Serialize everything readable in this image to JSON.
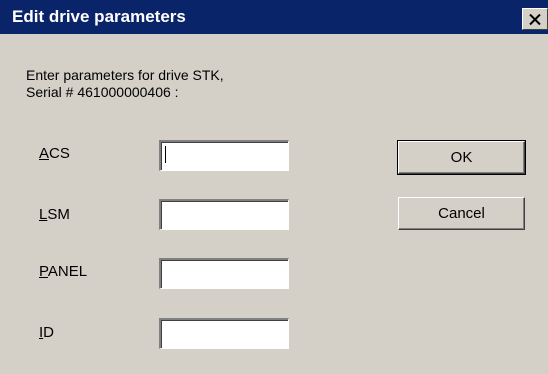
{
  "window": {
    "title": "Edit drive parameters",
    "close_icon": "close-icon"
  },
  "prompt": {
    "line1": "Enter parameters for drive STK,",
    "line2": "Serial # 461000000406 :"
  },
  "fields": [
    {
      "mnemonic": "A",
      "rest": "CS",
      "value": ""
    },
    {
      "mnemonic": "L",
      "rest": "SM",
      "value": ""
    },
    {
      "mnemonic": "P",
      "rest": "ANEL",
      "value": ""
    },
    {
      "mnemonic": "I",
      "rest": "D",
      "value": ""
    }
  ],
  "buttons": {
    "ok_label": "OK",
    "cancel_label": "Cancel"
  },
  "colors": {
    "titlebar": "#0a246a",
    "face": "#d4d0c8"
  }
}
